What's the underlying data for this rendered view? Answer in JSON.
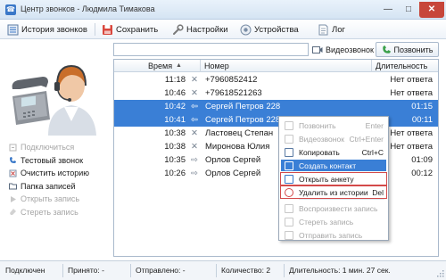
{
  "window": {
    "title": "Центр звонков - Людмила Тимакова"
  },
  "toolbar": {
    "history": "История звонков",
    "save": "Сохранить",
    "settings": "Настройки",
    "devices": "Устройства",
    "log": "Лог"
  },
  "sidebar": {
    "items": [
      {
        "label": "Подключиться",
        "enabled": false
      },
      {
        "label": "Тестовый звонок",
        "enabled": true
      },
      {
        "label": "Очистить историю",
        "enabled": true
      },
      {
        "label": "Папка записей",
        "enabled": true
      },
      {
        "label": "Открыть запись",
        "enabled": false
      },
      {
        "label": "Стереть запись",
        "enabled": false
      }
    ]
  },
  "search": {
    "value": "",
    "placeholder": ""
  },
  "video_call": {
    "label": "Видеозвонок",
    "checked": false
  },
  "call_button": {
    "label": "Позвонить"
  },
  "table": {
    "headers": {
      "time": "Время",
      "number": "Номер",
      "duration": "Длительность"
    },
    "rows": [
      {
        "time": "11:18",
        "icon": "missed-call-icon",
        "number": "+7960852412",
        "duration": "Нет ответа",
        "selected": false
      },
      {
        "time": "10:46",
        "icon": "missed-call-icon",
        "number": "+79618521263",
        "duration": "Нет ответа",
        "selected": false
      },
      {
        "time": "10:42",
        "icon": "incoming-call-icon",
        "number": "Сергей Петров 228",
        "duration": "01:15",
        "selected": true
      },
      {
        "time": "10:41",
        "icon": "incoming-call-icon",
        "number": "Сергей Петров 228",
        "duration": "00:11",
        "selected": true
      },
      {
        "time": "10:38",
        "icon": "missed-call-icon",
        "number": "Ластовец Степан",
        "duration": "Нет ответа",
        "selected": false
      },
      {
        "time": "10:38",
        "icon": "missed-call-icon",
        "number": "Миронова Юлия",
        "duration": "Нет ответа",
        "selected": false
      },
      {
        "time": "10:35",
        "icon": "outgoing-call-icon",
        "number": "Орлов Сергей",
        "duration": "01:09",
        "selected": false
      },
      {
        "time": "10:26",
        "icon": "outgoing-call-icon",
        "number": "Орлов Сергей",
        "duration": "00:12",
        "selected": false
      }
    ]
  },
  "context_menu": {
    "items": [
      {
        "label": "Позвонить",
        "shortcut": "Enter",
        "enabled": false,
        "icon": "phone-icon"
      },
      {
        "label": "Видеозвонок",
        "shortcut": "Ctrl+Enter",
        "enabled": false,
        "icon": "video-icon"
      },
      {
        "label": "Копировать",
        "shortcut": "Ctrl+C",
        "enabled": true,
        "icon": "copy-icon"
      },
      {
        "label": "Создать контакт",
        "shortcut": "",
        "enabled": true,
        "icon": "add-contact-icon"
      },
      {
        "label": "Открыть анкету",
        "shortcut": "",
        "enabled": true,
        "icon": "open-form-icon"
      },
      {
        "label": "Удалить из истории",
        "shortcut": "Del",
        "enabled": true,
        "icon": "delete-icon"
      },
      {
        "label": "Воспроизвести запись",
        "shortcut": "",
        "enabled": false,
        "icon": "play-icon"
      },
      {
        "label": "Стереть запись",
        "shortcut": "",
        "enabled": false,
        "icon": "erase-icon"
      },
      {
        "label": "Отправить запись",
        "shortcut": "",
        "enabled": false,
        "icon": "send-icon"
      }
    ]
  },
  "status": {
    "connection": "Подключен",
    "received": "Принято: -",
    "sent": "Отправлено: -",
    "count": "Количество: 2",
    "duration": "Длительность: 1 мин. 27 сек."
  },
  "colors": {
    "accent": "#3a7fd6",
    "highlight_border": "#d34a4a",
    "close_button": "#c7463a"
  }
}
